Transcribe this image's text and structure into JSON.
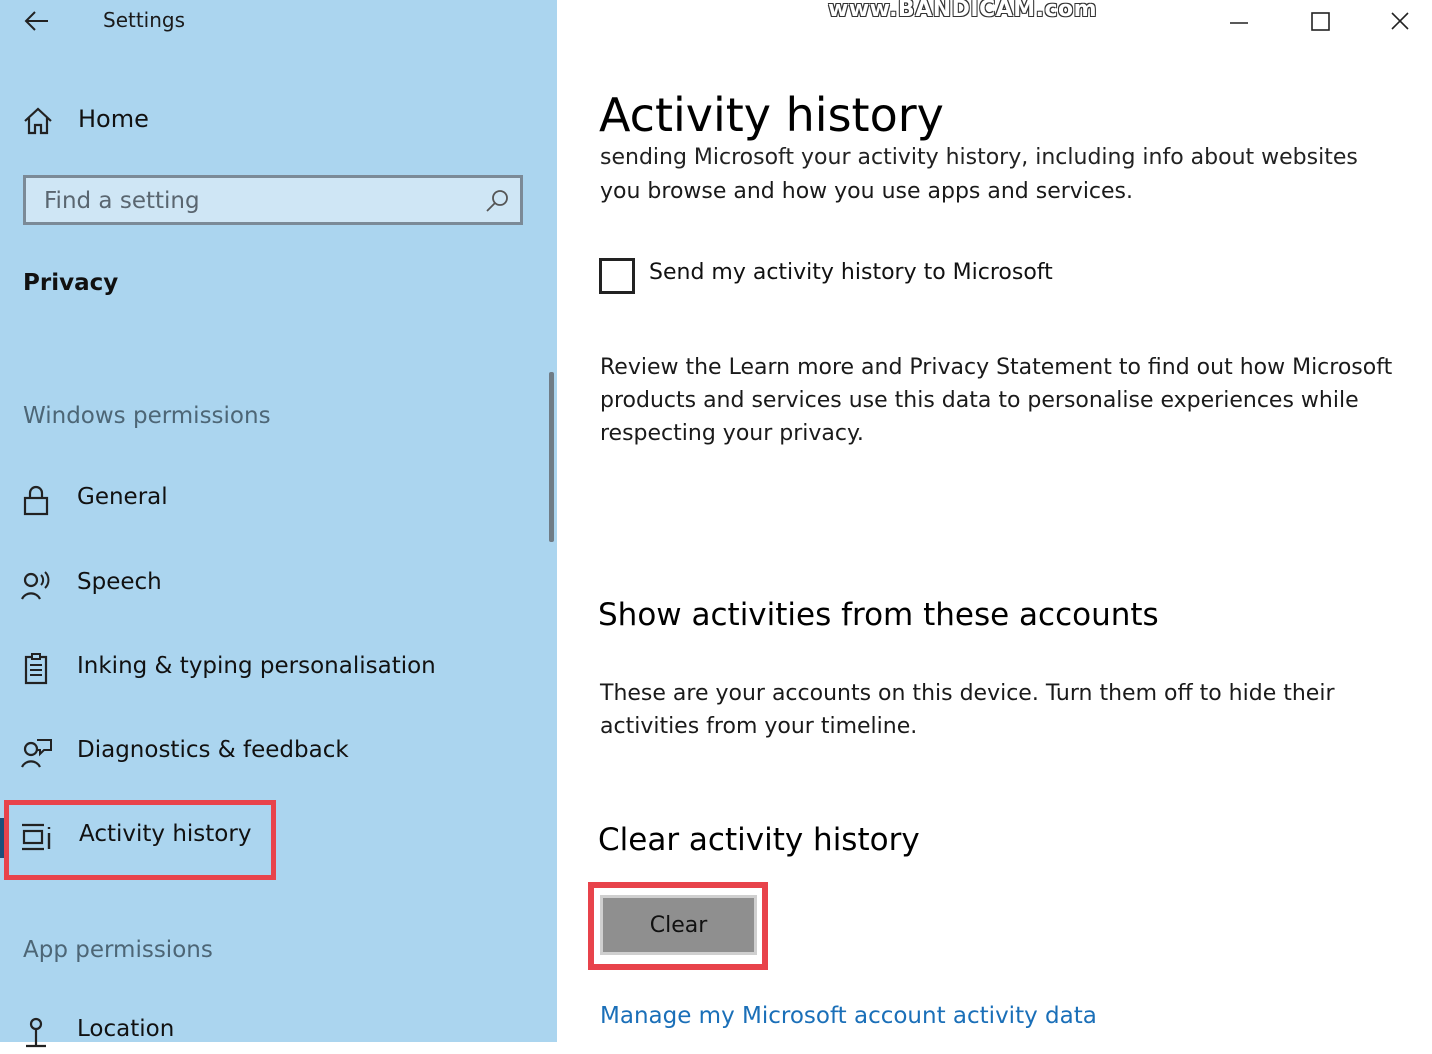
{
  "app": {
    "title": "Settings"
  },
  "sidebar": {
    "home_label": "Home",
    "search_placeholder": "Find a setting",
    "section_title": "Privacy",
    "windows_permissions_label": "Windows permissions",
    "items": [
      {
        "label": "General",
        "icon": "lock-icon"
      },
      {
        "label": "Speech",
        "icon": "speech-icon"
      },
      {
        "label": "Inking & typing personalisation",
        "icon": "clipboard-icon"
      },
      {
        "label": "Diagnostics & feedback",
        "icon": "feedback-icon"
      },
      {
        "label": "Activity history",
        "icon": "activity-history-icon",
        "selected": true
      }
    ],
    "app_permissions_label": "App permissions",
    "app_items": [
      {
        "label": "Location",
        "icon": "location-icon"
      }
    ]
  },
  "watermark": "www.BANDICAM.com",
  "main": {
    "title": "Activity history",
    "clipped_line": "sending Microsoft your activity history, including info about websites",
    "intro_line": "you browse and how you use apps and services.",
    "send_checkbox_label": "Send my activity history to Microsoft",
    "send_checkbox_checked": false,
    "review_text_lines": [
      "Review the Learn more and Privacy Statement to find out how Microsoft",
      "products and services use this data to personalise experiences while",
      "respecting your privacy."
    ],
    "accounts_heading": "Show activities from these accounts",
    "accounts_text_lines": [
      "These are your accounts on this device. Turn them off to hide their",
      "activities from your timeline."
    ],
    "clear_heading": "Clear activity history",
    "clear_button": "Clear",
    "manage_link": "Manage my Microsoft account activity data"
  },
  "colors": {
    "sidebar_bg": "#abd5ef",
    "highlight": "#e8434b",
    "link": "#1a6fb8",
    "button_bg": "#8f8f8f"
  }
}
